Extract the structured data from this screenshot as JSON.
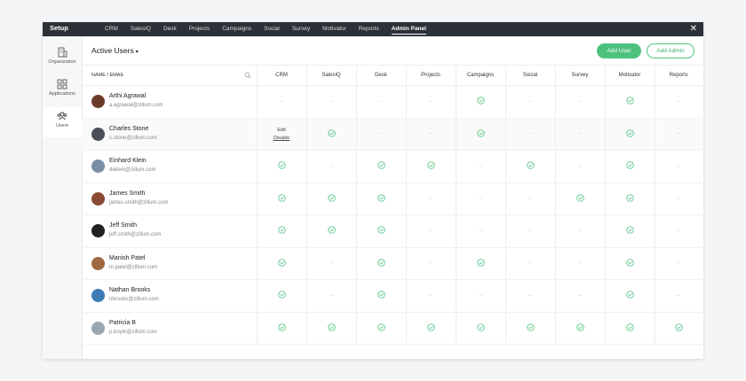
{
  "topbar": {
    "title": "Setup",
    "nav": [
      "CRM",
      "SalesIQ",
      "Desk",
      "Projects",
      "Campaigns",
      "Social",
      "Survey",
      "Motivator",
      "Reports",
      "Admin Panel"
    ],
    "active_nav": "Admin Panel",
    "close_label": "✕"
  },
  "sidebar": {
    "items": [
      {
        "label": "Organization",
        "icon": "building-icon"
      },
      {
        "label": "Applications",
        "icon": "apps-grid-icon"
      },
      {
        "label": "Users",
        "icon": "users-icon",
        "active": true
      }
    ]
  },
  "header": {
    "view_title": "Active Users",
    "caret": "▾",
    "add_user": "Add User",
    "add_admin": "Add Admin"
  },
  "table": {
    "name_header": "NAME / EMAIL",
    "columns": [
      "CRM",
      "SalesIQ",
      "Desk",
      "Projects",
      "Campaigns",
      "Social",
      "Survey",
      "Motivator",
      "Reports"
    ],
    "row_actions": {
      "edit": "Edit",
      "disable": "Disable"
    },
    "dash": "–",
    "rows": [
      {
        "name": "Arthi Agrawal",
        "email": "a.agrawal@zillum.com",
        "avatar_color": "#6b3b2a",
        "access": [
          false,
          false,
          false,
          false,
          true,
          false,
          false,
          true,
          false
        ]
      },
      {
        "name": "Charles Stone",
        "email": "c.stone@zillum.com",
        "avatar_color": "#4a4f58",
        "access": [
          null,
          true,
          false,
          false,
          true,
          false,
          false,
          true,
          false
        ],
        "highlight": true
      },
      {
        "name": "Einhard Klein",
        "email": "dieterk@zillum.com",
        "avatar_color": "#7a8fa6",
        "access": [
          true,
          false,
          true,
          true,
          false,
          true,
          false,
          true,
          false
        ]
      },
      {
        "name": "James Smith",
        "email": "james.smith@zillum.com",
        "avatar_color": "#8a4b34",
        "access": [
          true,
          true,
          true,
          false,
          false,
          false,
          true,
          true,
          false
        ]
      },
      {
        "name": "Jeff Smith",
        "email": "jeff.smith@zillum.com",
        "avatar_color": "#222222",
        "access": [
          true,
          true,
          true,
          false,
          false,
          false,
          false,
          true,
          false
        ]
      },
      {
        "name": "Manish Patel",
        "email": "m.patel@zillum.com",
        "avatar_color": "#a0683e",
        "access": [
          true,
          false,
          true,
          false,
          true,
          false,
          false,
          true,
          false
        ]
      },
      {
        "name": "Nathan Brooks",
        "email": "nbrooks@zillum.com",
        "avatar_color": "#3d7bb5",
        "access": [
          true,
          false,
          true,
          false,
          false,
          false,
          false,
          true,
          false
        ]
      },
      {
        "name": "Patricia B",
        "email": "p.boyle@zillum.com",
        "avatar_color": "#9aa7b2",
        "access": [
          true,
          true,
          true,
          true,
          true,
          true,
          true,
          true,
          true
        ]
      }
    ]
  },
  "colors": {
    "accent_green": "#4dc27e",
    "topbar_bg": "#2b3137"
  }
}
